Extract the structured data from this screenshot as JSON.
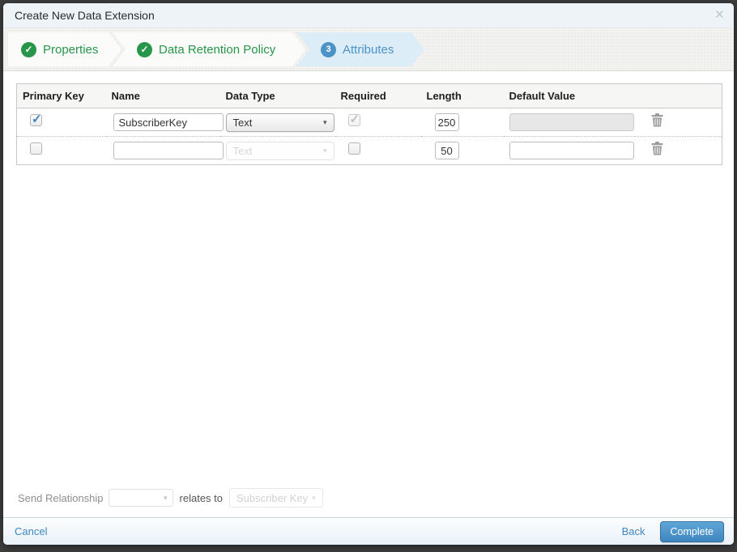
{
  "modal": {
    "title": "Create New Data Extension",
    "close_glyph": "×"
  },
  "wizard": {
    "steps": [
      {
        "label": "Properties",
        "status": "complete",
        "badge": "✓"
      },
      {
        "label": "Data Retention Policy",
        "status": "complete",
        "badge": "✓"
      },
      {
        "label": "Attributes",
        "status": "active",
        "badge": "3"
      }
    ]
  },
  "attributes_table": {
    "headers": {
      "primary_key": "Primary Key",
      "name": "Name",
      "data_type": "Data Type",
      "required": "Required",
      "length": "Length",
      "default_value": "Default Value"
    },
    "rows": [
      {
        "primary_key_checked": true,
        "name": "SubscriberKey",
        "data_type": "Text",
        "data_type_disabled": false,
        "required_checked": true,
        "required_disabled": true,
        "length": "250",
        "default_value": "",
        "default_value_disabled": true
      },
      {
        "primary_key_checked": false,
        "name": "",
        "data_type": "Text",
        "data_type_disabled": true,
        "required_checked": false,
        "required_disabled": false,
        "length": "50",
        "default_value": "",
        "default_value_disabled": false
      }
    ],
    "select_arrow": "▾"
  },
  "send_relationship": {
    "label": "Send Relationship",
    "relates_label": "relates to",
    "target_value": "Subscriber Key",
    "arrow": "▾"
  },
  "footer": {
    "cancel_label": "Cancel",
    "back_label": "Back",
    "complete_label": "Complete"
  },
  "colors": {
    "step_complete_green": "#27954a",
    "step_active_blue": "#4b93c7",
    "step_active_bg": "#dcedf7",
    "link_blue": "#3e86c2",
    "complete_button_blue": "#4e96cc",
    "backdrop": "#3e3e3e",
    "checkbox_check_blue": "#3c83c2"
  }
}
